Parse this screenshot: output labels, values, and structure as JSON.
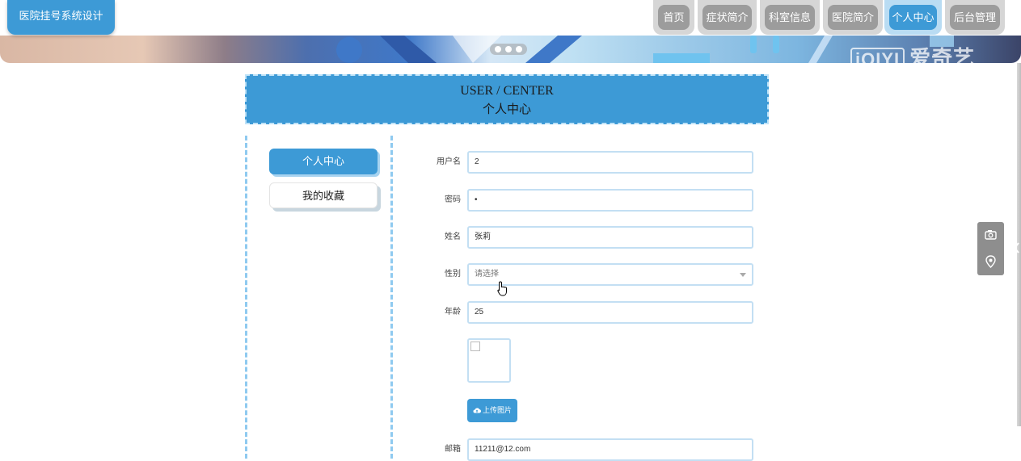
{
  "site": {
    "title": "医院挂号系统设计"
  },
  "nav": {
    "items": [
      {
        "label": "首页",
        "active": false
      },
      {
        "label": "症状简介",
        "active": false
      },
      {
        "label": "科室信息",
        "active": false
      },
      {
        "label": "医院简介",
        "active": false
      },
      {
        "label": "个人中心",
        "active": true
      },
      {
        "label": "后台管理",
        "active": false
      }
    ]
  },
  "banner": {
    "watermark_text": "爱奇艺",
    "watermark_logo": "iQIYI"
  },
  "page_header": {
    "title_en": "USER / CENTER",
    "title_cn": "个人中心"
  },
  "sidebar": {
    "items": [
      {
        "label": "个人中心",
        "active": true
      },
      {
        "label": "我的收藏",
        "active": false
      }
    ]
  },
  "form": {
    "username": {
      "label": "用户名",
      "value": "2"
    },
    "password": {
      "label": "密码",
      "value": "•"
    },
    "name": {
      "label": "姓名",
      "value": "张莉"
    },
    "gender": {
      "label": "性别",
      "placeholder": "请选择"
    },
    "age": {
      "label": "年龄",
      "value": "25"
    },
    "upload_label": "上传图片",
    "email": {
      "label": "邮箱",
      "value": "11211@12.com"
    }
  },
  "icons": {
    "camera": "camera-icon",
    "location": "location-icon",
    "arrow": "chevron-left-icon",
    "upload": "cloud-upload-icon"
  },
  "colors": {
    "primary": "#3d9ad6",
    "nav_inactive": "#9c9c9c",
    "border_light": "#c3dff3"
  }
}
